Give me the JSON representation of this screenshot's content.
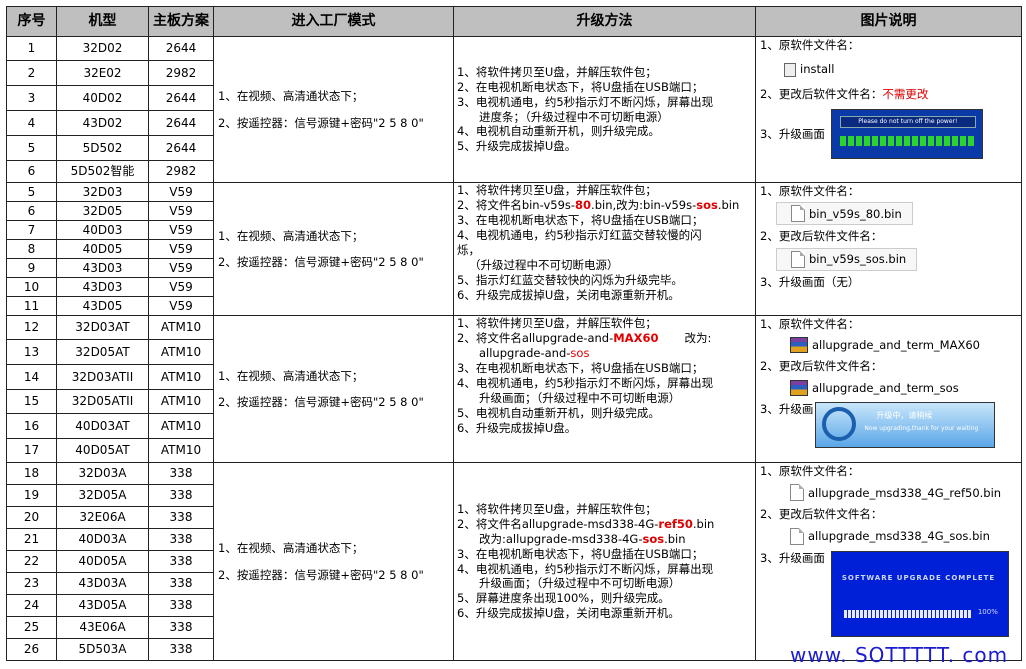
{
  "headers": [
    "序号",
    "机型",
    "主板方案",
    "进入工厂模式",
    "升级方法",
    "图片说明"
  ],
  "entry_steps": [
    "1、在视频、高清通状态下；",
    "2、按遥控器：信号源键+密码\"2 5 8 0\""
  ],
  "groups": [
    {
      "rows": [
        [
          "1",
          "32D02",
          "2644"
        ],
        [
          "2",
          "32E02",
          "2982"
        ],
        [
          "3",
          "40D02",
          "2644"
        ],
        [
          "4",
          "43D02",
          "2644"
        ],
        [
          "5",
          "5D502",
          "2644"
        ],
        [
          "6",
          "5D502智能",
          "2982"
        ]
      ],
      "steps": [
        "1、将软件拷贝至U盘，并解压软件包；",
        "2、在电视机断电状态下，将U盘插在USB端口；",
        "3、电视机通电，约5秒指示灯不断闪烁，屏幕出现",
        "进度条；（升级过程中不可切断电源）",
        "4、电视机自动重新开机，则升级完成。",
        "5、升级完成拔掉U盘。"
      ],
      "pic": {
        "orig_label": "1、原软件文件名：",
        "orig_file": "install",
        "rename_label": "2、更改后软件文件名：",
        "rename_value": "不需更改",
        "screen_label": "3、升级画面",
        "screen_text": "Please do not turn off the power!"
      }
    },
    {
      "rows": [
        [
          "5",
          "32D03",
          "V59"
        ],
        [
          "6",
          "32D05",
          "V59"
        ],
        [
          "7",
          "40D03",
          "V59"
        ],
        [
          "8",
          "40D05",
          "V59"
        ],
        [
          "9",
          "43D03",
          "V59"
        ],
        [
          "10",
          "43D03",
          "V59"
        ],
        [
          "11",
          "43D05",
          "V59"
        ]
      ],
      "steps": {
        "s1": "1、将软件拷贝至U盘，并解压软件包；",
        "s2a": "2、将文件名bin-v59s-",
        "s2r1": "80",
        "s2b": ".bin,改为:bin-v59s-",
        "s2r2": "sos",
        "s2c": ".bin",
        "s3": "3、在电视机断电状态下，将U盘插在USB端口；",
        "s4": "4、电视机通电，约5秒指示灯红蓝交替较慢的闪",
        "s4b": "烁，",
        "s4c": "（升级过程中不可切断电源）",
        "s5": "5、指示灯红蓝交替较快的闪烁为升级完毕。",
        "s6": "6、升级完成拔掉U盘，关闭电源重新开机。"
      },
      "pic": {
        "orig_label": "1、原软件文件名：",
        "orig_file": "bin_v59s_80.bin",
        "rename_label": "2、更改后软件文件名：",
        "rename_file": "bin_v59s_sos.bin",
        "screen_label": "3、升级画面（无）"
      }
    },
    {
      "rows": [
        [
          "12",
          "32D03AT",
          "ATM10"
        ],
        [
          "13",
          "32D05AT",
          "ATM10"
        ],
        [
          "14",
          "32D03ATII",
          "ATM10"
        ],
        [
          "15",
          "32D05ATII",
          "ATM10"
        ],
        [
          "16",
          "40D03AT",
          "ATM10"
        ],
        [
          "17",
          "40D05AT",
          "ATM10"
        ]
      ],
      "steps": {
        "s1": "1、将软件拷贝至U盘，并解压软件包；",
        "s2a": "2、将文件名allupgrade-and-",
        "s2r1": "MAX60",
        "s2b": "改为:",
        "s2c": "allupgrade-and-",
        "s2r2": "sos",
        "s3": "3、在电视机断电状态下，将U盘插在USB端口；",
        "s4": "4、电视机通电，约5秒指示灯不断闪烁，屏幕出现",
        "s4b": "升级画面；（升级过程中不可切断电源）",
        "s5": "5、电视机自动重新开机，则升级完成。",
        "s6": "6、升级完成拔掉U盘。"
      },
      "pic": {
        "orig_label": "1、原软件文件名：",
        "orig_file": "allupgrade_and_term_MAX60",
        "rename_label": "2、更改后软件文件名：",
        "rename_file": "allupgrade_and_term_sos",
        "screen_label": "3、升级画",
        "screen_t1": "升级中，请稍候",
        "screen_t2": "Now upgrading,thank for your waiting"
      }
    },
    {
      "rows": [
        [
          "18",
          "32D03A",
          "338"
        ],
        [
          "19",
          "32D05A",
          "338"
        ],
        [
          "20",
          "32E06A",
          "338"
        ],
        [
          "21",
          "40D03A",
          "338"
        ],
        [
          "22",
          "40D05A",
          "338"
        ],
        [
          "23",
          "43D03A",
          "338"
        ],
        [
          "24",
          "43D05A",
          "338"
        ],
        [
          "25",
          "43E06A",
          "338"
        ],
        [
          "26",
          "5D503A",
          "338"
        ]
      ],
      "steps": {
        "s1": "1、将软件拷贝至U盘，并解压软件包；",
        "s2a": "2、将文件名allupgrade-msd338-4G-",
        "s2r1": "ref50",
        "s2b": ".bin",
        "s2c": "改为:allupgrade-msd338-4G-",
        "s2r2": "sos",
        "s2d": ".bin",
        "s3": "3、在电视机断电状态下，将U盘插在USB端口；",
        "s4": "4、电视机通电，约5秒指示灯不断闪烁，屏幕出现",
        "s4b": "升级画面；（升级过程中不可切断电源）",
        "s5": "5、屏幕进度条出现100%，则升级完成。",
        "s6": "6、升级完成拔掉U盘，关闭电源重新开机。"
      },
      "pic": {
        "orig_label": "1、原软件文件名：",
        "orig_file": "allupgrade_msd338_4G_ref50.bin",
        "rename_label": "2、更改后软件文件名：",
        "rename_file": "allupgrade_msd338_4G_sos.bin",
        "screen_label": "3、升级画面",
        "screen_t": "SOFTWARE UPGRADE COMPLETE",
        "screen_p": "100%"
      }
    }
  ],
  "watermark": "www.  SOTTTTT.  com"
}
